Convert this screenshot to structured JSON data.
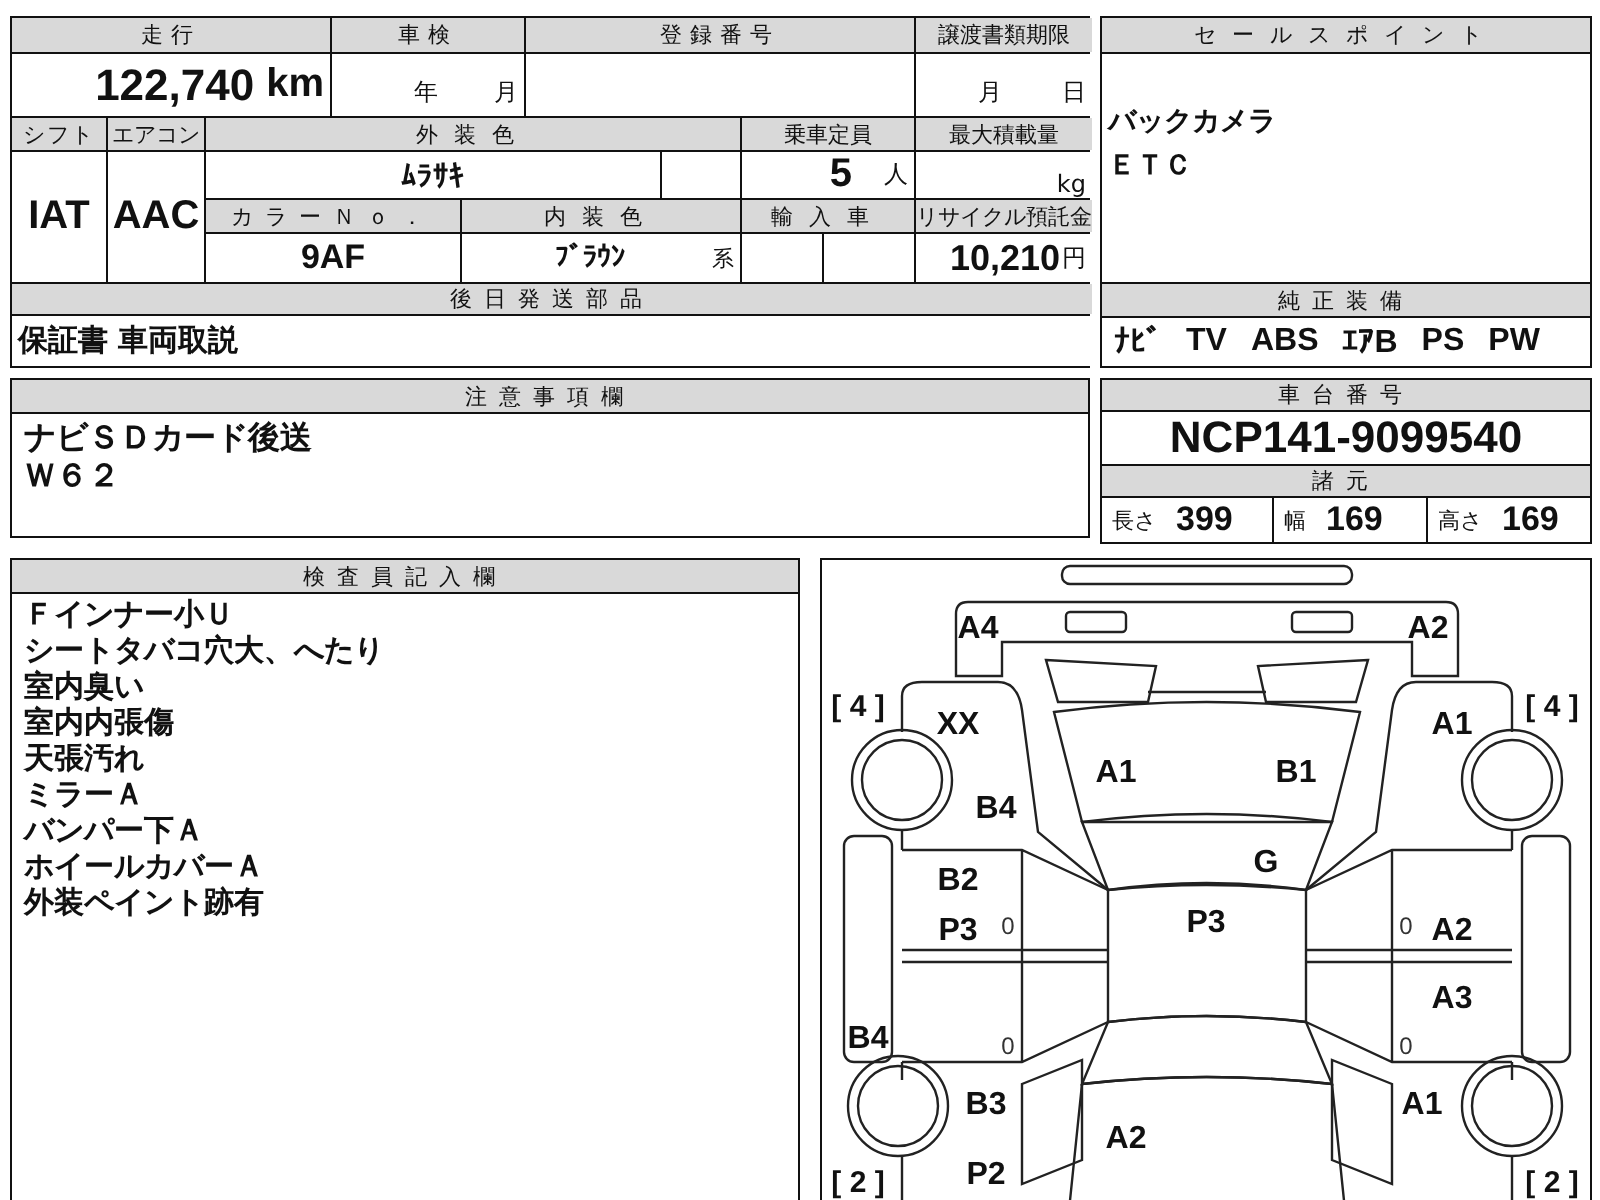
{
  "mileage": {
    "label": "走行",
    "value": "122,740",
    "unit": "km"
  },
  "inspection": {
    "label": "車検",
    "year_unit": "年",
    "month_unit": "月"
  },
  "registration": {
    "label": "登録番号"
  },
  "transfer_deadline": {
    "label": "譲渡書類期限",
    "month_unit": "月",
    "day_unit": "日"
  },
  "shift": {
    "label": "シフト",
    "value": "IAT"
  },
  "aircon": {
    "label": "エアコン",
    "value": "AAC"
  },
  "exterior_color": {
    "label": "外装色",
    "value": "ﾑﾗｻｷ"
  },
  "capacity": {
    "label": "乗車定員",
    "value": "5",
    "unit": "人"
  },
  "max_load": {
    "label": "最大積載量",
    "unit": "kg"
  },
  "color_no": {
    "label": "カラーＮｏ．",
    "value": "9AF"
  },
  "interior_color": {
    "label": "内装色",
    "value": "ﾌﾞﾗｳﾝ",
    "suffix": "系"
  },
  "import": {
    "label": "輸入車"
  },
  "recycle_fee": {
    "label": "リサイクル預託金",
    "value": "10,210",
    "unit": "円"
  },
  "later_parts": {
    "label": "後日発送部品",
    "value": "保証書 車両取説"
  },
  "sales_points": {
    "label": "セールスポイント",
    "lines": [
      "バックカメラ",
      "ＥＴＣ"
    ]
  },
  "equipment": {
    "label": "純正装備",
    "items": [
      "ﾅﾋﾞ",
      "TV",
      "ABS",
      "ｴｱB",
      "PS",
      "PW"
    ]
  },
  "notes": {
    "label": "注意事項欄",
    "lines": [
      "ナビＳＤカード後送",
      "Ｗ６２"
    ]
  },
  "chassis": {
    "label": "車台番号",
    "value": "NCP141-9099540"
  },
  "specs": {
    "label": "諸元",
    "items": [
      {
        "label": "長さ",
        "value": "399"
      },
      {
        "label": "幅",
        "value": "169"
      },
      {
        "label": "高さ",
        "value": "169"
      }
    ]
  },
  "inspector": {
    "label": "検査員記入欄",
    "lines": [
      "Ｆインナー小Ｕ",
      "シートタバコ穴大、へたり",
      "室内臭い",
      "室内内張傷",
      "天張汚れ",
      "ミラーＡ",
      "バンパー下Ａ",
      "ホイールカバーＡ",
      "外装ペイント跡有"
    ]
  },
  "diagram": {
    "marks": [
      {
        "kind": "code",
        "text": "A4"
      },
      {
        "kind": "code",
        "text": "A2"
      },
      {
        "kind": "tread",
        "text": "[ 4 ]"
      },
      {
        "kind": "tread",
        "text": "[ 4 ]"
      },
      {
        "kind": "code",
        "text": "XX"
      },
      {
        "kind": "code",
        "text": "A1"
      },
      {
        "kind": "code",
        "text": "A1"
      },
      {
        "kind": "code",
        "text": "B1"
      },
      {
        "kind": "code",
        "text": "B4"
      },
      {
        "kind": "code",
        "text": "G"
      },
      {
        "kind": "code",
        "text": "B2"
      },
      {
        "kind": "code",
        "text": "P3"
      },
      {
        "kind": "note",
        "text": "0"
      },
      {
        "kind": "code",
        "text": "P3"
      },
      {
        "kind": "note",
        "text": "0"
      },
      {
        "kind": "code",
        "text": "A2"
      },
      {
        "kind": "code",
        "text": "A3"
      },
      {
        "kind": "code",
        "text": "B4"
      },
      {
        "kind": "note",
        "text": "0"
      },
      {
        "kind": "note",
        "text": "0"
      },
      {
        "kind": "code",
        "text": "B3"
      },
      {
        "kind": "code",
        "text": "A1"
      },
      {
        "kind": "code",
        "text": "A2"
      },
      {
        "kind": "tread",
        "text": "[ 2 ]"
      },
      {
        "kind": "code",
        "text": "P2"
      },
      {
        "kind": "tread",
        "text": "[ 2 ]"
      }
    ]
  }
}
